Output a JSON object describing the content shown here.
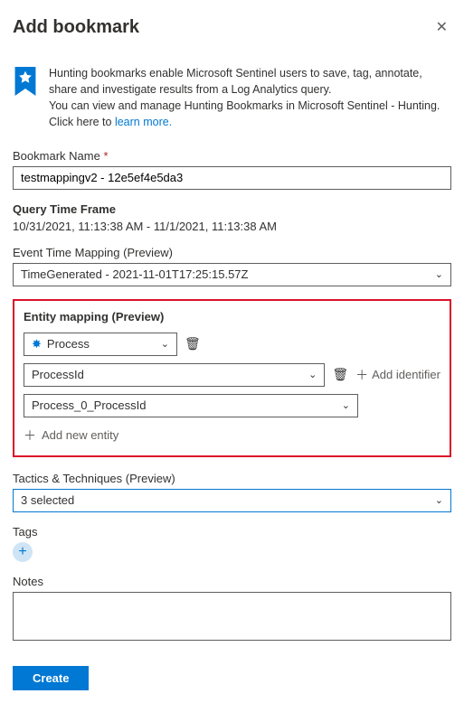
{
  "header": {
    "title": "Add bookmark"
  },
  "info": {
    "line1": "Hunting bookmarks enable Microsoft Sentinel users to save, tag, annotate, share and investigate results from a Log Analytics query.",
    "line2_prefix": "You can view and manage Hunting Bookmarks in Microsoft Sentinel - Hunting. Click here to ",
    "learn_more": "learn more."
  },
  "bookmark_name": {
    "label": "Bookmark Name",
    "value": "testmappingv2 - 12e5ef4e5da3"
  },
  "time_frame": {
    "label": "Query Time Frame",
    "value": "10/31/2021, 11:13:38 AM - 11/1/2021, 11:13:38 AM"
  },
  "event_time": {
    "label": "Event Time Mapping (Preview)",
    "value": "TimeGenerated - 2021-11-01T17:25:15.57Z"
  },
  "entity": {
    "label": "Entity mapping (Preview)",
    "type_value": "Process",
    "identifier_value": "ProcessId",
    "column_value": "Process_0_ProcessId",
    "add_identifier": "Add identifier",
    "add_entity": "Add new entity"
  },
  "tactics": {
    "label": "Tactics & Techniques (Preview)",
    "value": "3 selected"
  },
  "tags": {
    "label": "Tags"
  },
  "notes": {
    "label": "Notes"
  },
  "buttons": {
    "create": "Create"
  }
}
